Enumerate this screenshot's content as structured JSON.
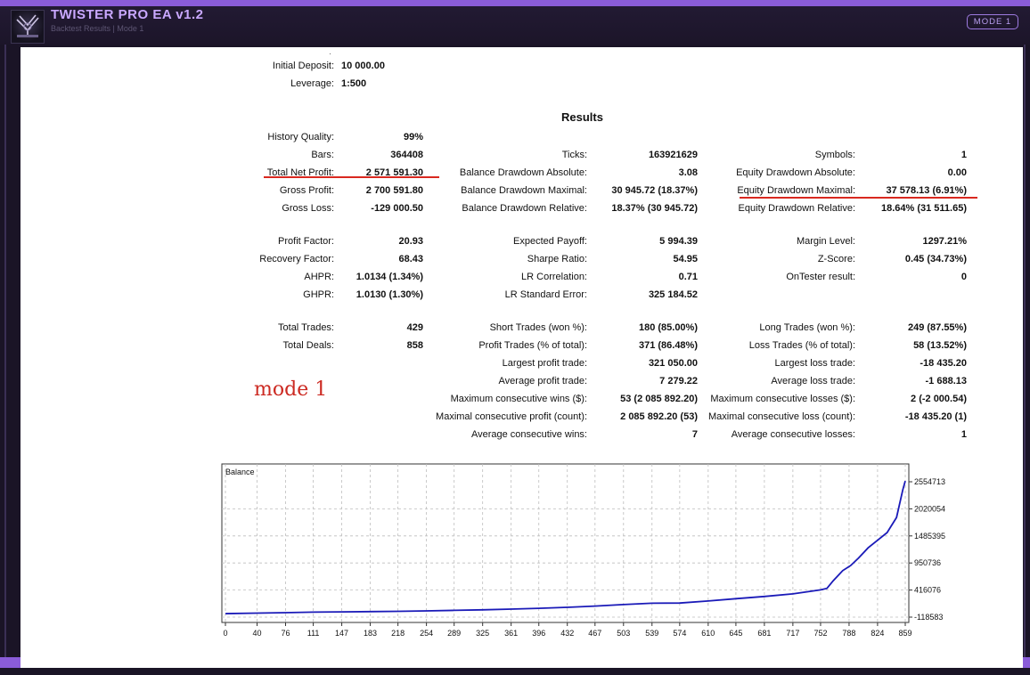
{
  "app": {
    "title": "TWISTER PRO EA  v1.2",
    "subtitle": "Backtest Results  |  Mode 1",
    "mode_button": "MODE 1",
    "colors": {
      "accent": "#8a5cd8",
      "title": "#c9a8ff",
      "annotation": "#d9281f",
      "balance_line": "#1a1ab8"
    },
    "logo_icon": "twister-logo-icon"
  },
  "report": {
    "initial_deposit_label": "Initial Deposit:",
    "initial_deposit_value": "10 000.00",
    "leverage_label": "Leverage:",
    "leverage_value": "1:500",
    "results_title": "Results",
    "col1": [
      {
        "label": "History Quality:",
        "value": "99%"
      },
      {
        "label": "Bars:",
        "value": "364408"
      },
      {
        "label": "Total Net Profit:",
        "value": "2 571 591.30"
      },
      {
        "label": "Gross Profit:",
        "value": "2 700 591.80"
      },
      {
        "label": "Gross Loss:",
        "value": "-129 000.50"
      },
      {
        "label": "Profit Factor:",
        "value": "20.93"
      },
      {
        "label": "Recovery Factor:",
        "value": "68.43"
      },
      {
        "label": "AHPR:",
        "value": "1.0134 (1.34%)"
      },
      {
        "label": "GHPR:",
        "value": "1.0130 (1.30%)"
      },
      {
        "label": "Total Trades:",
        "value": "429"
      },
      {
        "label": "Total Deals:",
        "value": "858"
      }
    ],
    "col2": [
      {
        "label": "Ticks:",
        "value": "163921629"
      },
      {
        "label": "Balance Drawdown Absolute:",
        "value": "3.08"
      },
      {
        "label": "Balance Drawdown Maximal:",
        "value": "30 945.72 (18.37%)"
      },
      {
        "label": "Balance Drawdown Relative:",
        "value": "18.37% (30 945.72)"
      },
      {
        "label": "Expected Payoff:",
        "value": "5 994.39"
      },
      {
        "label": "Sharpe Ratio:",
        "value": "54.95"
      },
      {
        "label": "LR Correlation:",
        "value": "0.71"
      },
      {
        "label": "LR Standard Error:",
        "value": "325 184.52"
      },
      {
        "label": "Short Trades (won %):",
        "value": "180 (85.00%)"
      },
      {
        "label": "Profit Trades (% of total):",
        "value": "371 (86.48%)"
      },
      {
        "label": "Largest profit trade:",
        "value": "321 050.00"
      },
      {
        "label": "Average profit trade:",
        "value": "7 279.22"
      },
      {
        "label": "Maximum consecutive wins ($):",
        "value": "53 (2 085 892.20)"
      },
      {
        "label": "Maximal consecutive profit (count):",
        "value": "2 085 892.20 (53)"
      },
      {
        "label": "Average consecutive wins:",
        "value": "7"
      }
    ],
    "col3": [
      {
        "label": "Symbols:",
        "value": "1"
      },
      {
        "label": "Equity Drawdown Absolute:",
        "value": "0.00"
      },
      {
        "label": "Equity Drawdown Maximal:",
        "value": "37 578.13 (6.91%)"
      },
      {
        "label": "Equity Drawdown Relative:",
        "value": "18.64% (31 511.65)"
      },
      {
        "label": "Margin Level:",
        "value": "1297.21%"
      },
      {
        "label": "Z-Score:",
        "value": "0.45 (34.73%)"
      },
      {
        "label": "OnTester result:",
        "value": "0"
      },
      {
        "label": "Long Trades (won %):",
        "value": "249 (87.55%)"
      },
      {
        "label": "Loss Trades (% of total):",
        "value": "58 (13.52%)"
      },
      {
        "label": "Largest loss trade:",
        "value": "-18 435.20"
      },
      {
        "label": "Average loss trade:",
        "value": "-1 688.13"
      },
      {
        "label": "Maximum consecutive losses ($):",
        "value": "2 (-2 000.54)"
      },
      {
        "label": "Maximal consecutive loss (count):",
        "value": "-18 435.20 (1)"
      },
      {
        "label": "Average consecutive losses:",
        "value": "1"
      }
    ],
    "handwritten_note": "mode 1"
  },
  "chart_data": {
    "type": "line",
    "title": "Balance",
    "x_ticks": [
      "0",
      "40",
      "76",
      "111",
      "147",
      "183",
      "218",
      "254",
      "289",
      "325",
      "361",
      "396",
      "432",
      "467",
      "503",
      "539",
      "574",
      "610",
      "645",
      "681",
      "717",
      "752",
      "788",
      "824",
      "859"
    ],
    "y_ticks": [
      "2554713",
      "2020054",
      "1485395",
      "950736",
      "416076",
      "-118583"
    ],
    "ylim": [
      -118583,
      2554713
    ],
    "xlim": [
      0,
      859
    ],
    "grid": true,
    "series": [
      {
        "x": [
          0,
          40,
          76,
          111,
          147,
          183,
          218,
          254,
          289,
          325,
          361,
          396,
          432,
          467,
          503,
          539,
          574,
          610,
          645,
          681,
          717,
          752,
          760,
          768,
          780,
          790,
          800,
          812,
          824,
          836,
          848,
          856,
          859
        ],
        "y": [
          -50000,
          -40000,
          -30000,
          -20000,
          -15000,
          -10000,
          -5000,
          5000,
          15000,
          25000,
          40000,
          55000,
          75000,
          100000,
          130000,
          155000,
          160000,
          200000,
          245000,
          290000,
          340000,
          420000,
          450000,
          600000,
          800000,
          900000,
          1050000,
          1250000,
          1400000,
          1550000,
          1850000,
          2400000,
          2570000
        ]
      }
    ]
  }
}
